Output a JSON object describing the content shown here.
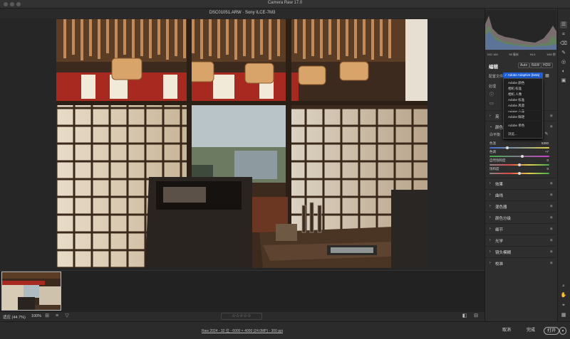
{
  "window": {
    "title": "Camera Raw 17.0"
  },
  "file": {
    "name": "DSC01051.ARW  ·  Sony ILCE-7M3"
  },
  "view": {
    "zoom_fit": "适应 (44.7%)",
    "zoom_100": "100%",
    "rating": "☆☆☆☆☆"
  },
  "status": {
    "metadata": "Raw 2024 - 32 位 - 6000 × 4000 (24.0MP) - 300 ppi"
  },
  "actions": {
    "cancel": "取消",
    "done": "完成",
    "open": "打开"
  },
  "histogram": {
    "info": [
      "ISO 160",
      "55 毫米",
      "f/4.0",
      "1/60 秒"
    ]
  },
  "edit": {
    "title": "编辑",
    "modes": [
      "Auto",
      "B&W",
      "HDR"
    ],
    "profile_label": "配置文件",
    "treatment_label": "处理",
    "profile_selected": "✓ Adobe Adaptive (beta)",
    "profile_options": [
      "Adobe 颜色",
      "相机 标准",
      "相机 人像",
      "Adobe 标准",
      "Adobe 风景",
      "Adobe 人像",
      "Adobe 鲜艳",
      "Adobe 单色",
      "浏览..."
    ],
    "sections_before": [
      "亮",
      "颜色"
    ],
    "wb_label": "白平衡",
    "sliders": [
      {
        "label": "色温",
        "value": "5300",
        "pos": 0.3
      },
      {
        "label": "色调",
        "value": "+7",
        "pos": 0.55
      },
      {
        "label": "自然饱和度",
        "value": "0",
        "pos": 0.5
      },
      {
        "label": "饱和度",
        "value": "0",
        "pos": 0.5
      }
    ],
    "sections": [
      "效果",
      "曲线",
      "混色器",
      "颜色分级",
      "细节",
      "光学",
      "镜头模糊",
      "校准"
    ]
  },
  "colors": {
    "accent": "#1f5fd6",
    "panel": "#2e2e2e",
    "canvas": "#262626"
  }
}
